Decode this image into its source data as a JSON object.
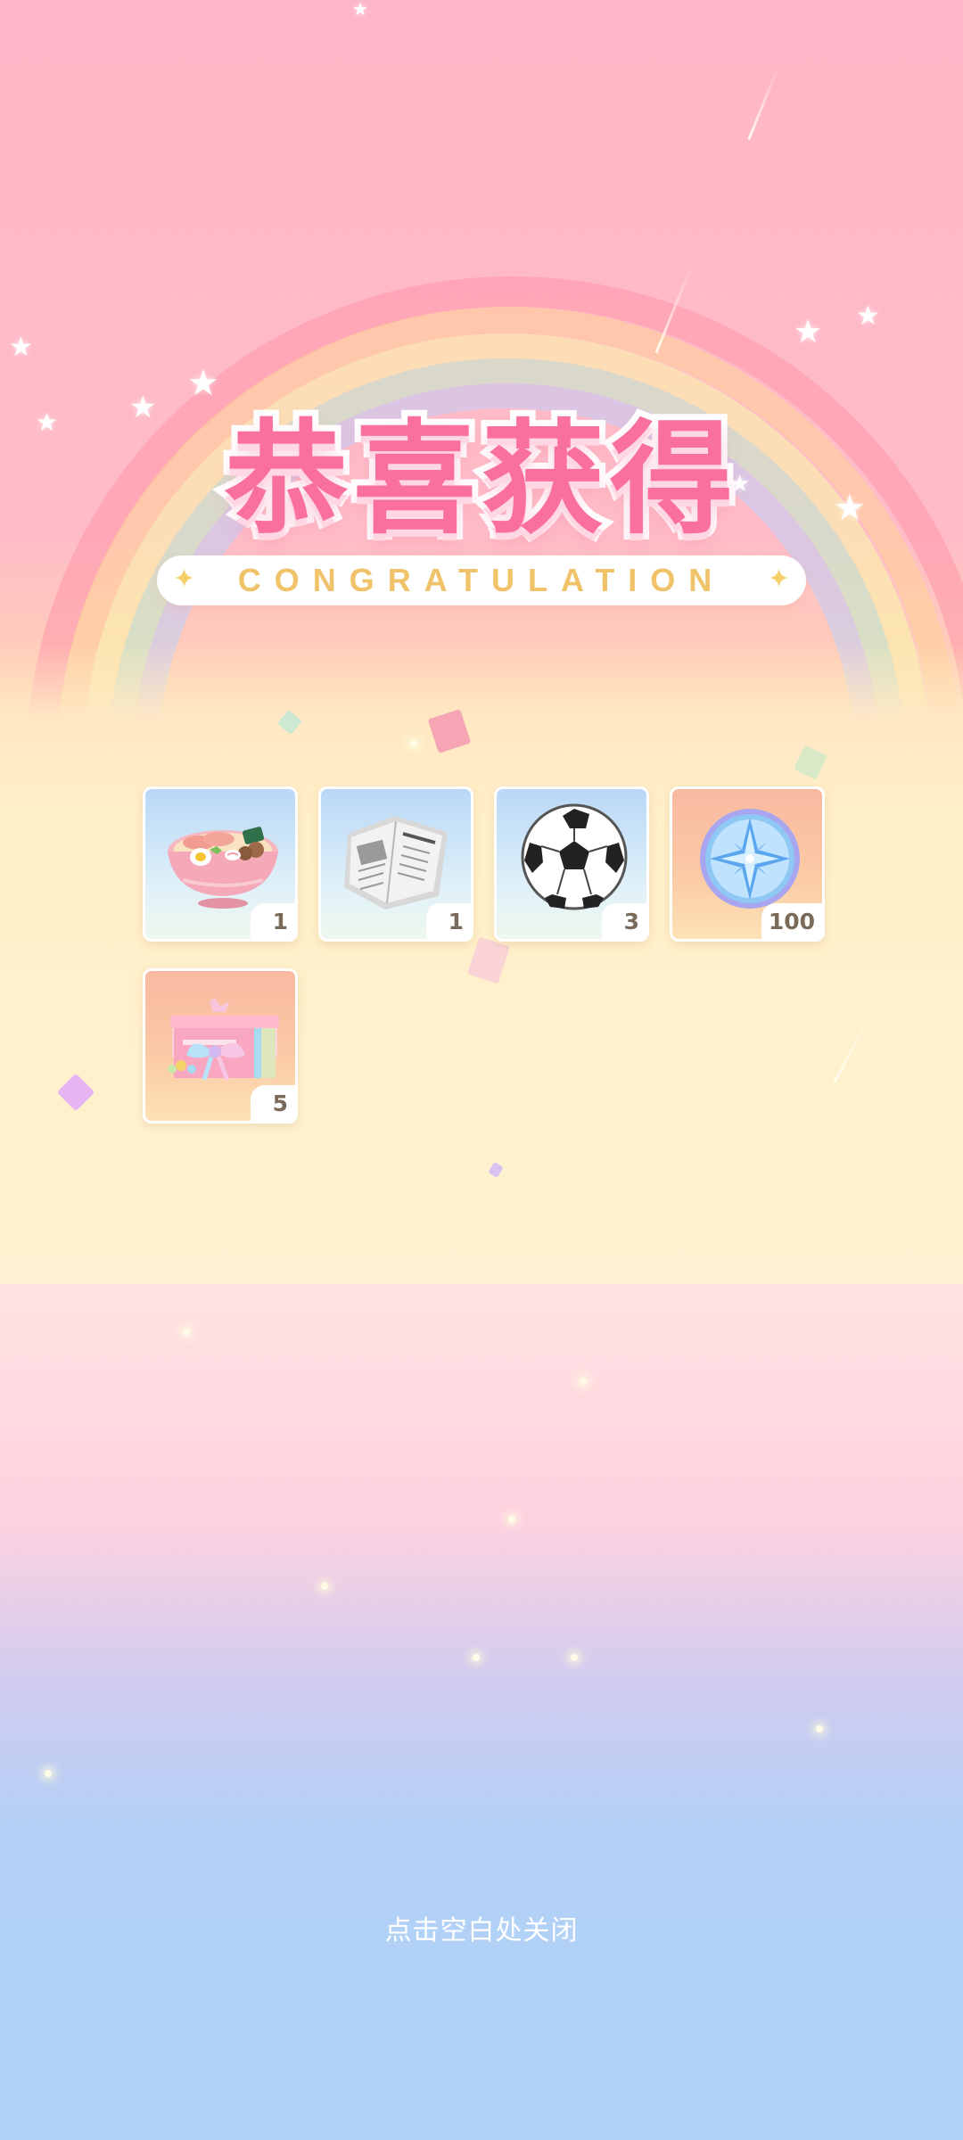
{
  "title": "恭喜获得",
  "subtitle": "CONGRATULATION",
  "rewards": [
    {
      "name": "ramen-bowl",
      "icon": "ramen-icon",
      "quantity": "1",
      "background": "#b9d8f7"
    },
    {
      "name": "newspaper",
      "icon": "newspaper-icon",
      "quantity": "1",
      "background": "#b9d8f7"
    },
    {
      "name": "soccer-ball",
      "icon": "soccer-ball-icon",
      "quantity": "3",
      "background": "#b9d8f7"
    },
    {
      "name": "star-coin",
      "icon": "star-coin-icon",
      "quantity": "100",
      "background": "#f9b9a1"
    },
    {
      "name": "gift-box",
      "icon": "gift-box-icon",
      "quantity": "5",
      "background": "#f9b9a1"
    }
  ],
  "close_hint": "点击空白处关闭",
  "colors": {
    "title_pink": "#f96f9d",
    "subtitle_gold": "#f0c36a",
    "quantity_text": "#7a6a5a"
  }
}
